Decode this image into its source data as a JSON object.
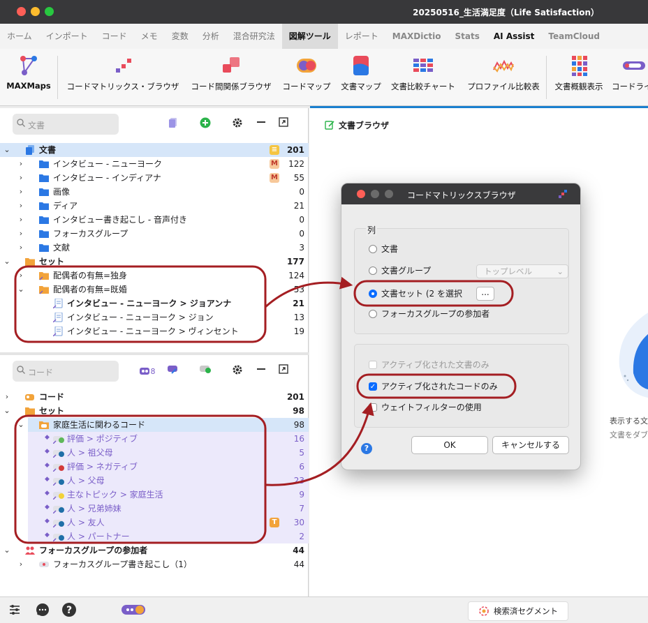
{
  "window": {
    "title": "20250516_生活満足度（Life Satisfaction）"
  },
  "ribbon_tabs": [
    {
      "label": "ホーム"
    },
    {
      "label": "インポート"
    },
    {
      "label": "コード"
    },
    {
      "label": "メモ"
    },
    {
      "label": "変数"
    },
    {
      "label": "分析"
    },
    {
      "label": "混合研究法"
    },
    {
      "label": "図解ツール"
    },
    {
      "label": "レポート"
    },
    {
      "label": "MAXDictio"
    },
    {
      "label": "Stats"
    },
    {
      "label": "AI Assist"
    },
    {
      "label": "TeamCloud"
    }
  ],
  "toolbar": [
    {
      "label": "MAXMaps",
      "icon": "maxmaps-icon"
    },
    {
      "label": "コードマトリックス・ブラウザ",
      "icon": "code-matrix-icon"
    },
    {
      "label": "コード間関係ブラウザ",
      "icon": "code-relations-icon"
    },
    {
      "label": "コードマップ",
      "icon": "code-map-icon"
    },
    {
      "label": "文書マップ",
      "icon": "document-map-icon"
    },
    {
      "label": "文書比較チャート",
      "icon": "document-comparison-icon"
    },
    {
      "label": "プロファイル比較表",
      "icon": "profile-comparison-icon"
    },
    {
      "label": "文書概観表示",
      "icon": "document-portrait-icon"
    },
    {
      "label": "コードライ",
      "icon": "codeline-icon"
    }
  ],
  "documents_panel": {
    "search_placeholder": "文書",
    "rows": [
      {
        "label": "文書",
        "count": "201"
      },
      {
        "label": "インタビュー - ニューヨーク",
        "count": "122"
      },
      {
        "label": "インタビュー - インディアナ",
        "count": "55"
      },
      {
        "label": "画像",
        "count": "0"
      },
      {
        "label": "ディア",
        "count": "21"
      },
      {
        "label": "インタビュー書き起こし - 音声付き",
        "count": "0"
      },
      {
        "label": "フォーカスグループ",
        "count": "0"
      },
      {
        "label": "文献",
        "count": "3"
      },
      {
        "label": "セット",
        "count": "177"
      },
      {
        "label": "配偶者の有無=独身",
        "count": "124"
      },
      {
        "label": "配偶者の有無=既婚",
        "count": "53"
      },
      {
        "label": "インタビュー - ニューヨーク > ジョアンナ",
        "count": "21"
      },
      {
        "label": "インタビュー - ニューヨーク > ジョン",
        "count": "13"
      },
      {
        "label": "インタビュー - ニューヨーク > ヴィンセント",
        "count": "19"
      }
    ],
    "badges": {
      "m": "M",
      "equals": "="
    }
  },
  "codes_panel": {
    "search_placeholder": "コード",
    "activated_count": "8",
    "rows": [
      {
        "label": "コード",
        "count": "201"
      },
      {
        "label": "セット",
        "count": "98"
      },
      {
        "label": "家庭生活に関わるコード",
        "count": "98"
      },
      {
        "label": "評価 > ポジティブ",
        "count": "16"
      },
      {
        "label": "人 > 祖父母",
        "count": "5"
      },
      {
        "label": "評価 > ネガティブ",
        "count": "6"
      },
      {
        "label": "人 > 父母",
        "count": "23"
      },
      {
        "label": "主なトピック > 家庭生活",
        "count": "9"
      },
      {
        "label": "人 > 兄弟姉妹",
        "count": "7"
      },
      {
        "label": "人 > 友人",
        "count": "30"
      },
      {
        "label": "人 > パートナー",
        "count": "2"
      },
      {
        "label": "フォーカスグループの参加者",
        "count": "44"
      },
      {
        "label": "フォーカスグループ書き起こし（1）",
        "count": "44"
      }
    ],
    "badge_t": "T"
  },
  "right_pane": {
    "title": "文書ブラウザ",
    "hint1": "表示する文",
    "hint2": "文書をダブ"
  },
  "dialog": {
    "title": "コードマトリックスブラウザ",
    "group_label": "列",
    "options": {
      "documents": "文書",
      "document_groups": "文書グループ",
      "document_sets": "文書セット (2 を選択",
      "focus_participants": "フォーカスグループの参加者"
    },
    "select_value": "トップレベル",
    "dots_label": "...",
    "checkboxes": {
      "activated_docs": "アクティブ化された文書のみ",
      "activated_codes": "アクティブ化されたコードのみ",
      "weight_filter": "ウェイトフィルターの使用"
    },
    "ok_label": "OK",
    "cancel_label": "キャンセルする",
    "help_label": "?"
  },
  "bottom_bar": {
    "retrieved_segments": "検索済セグメント"
  },
  "colors": {
    "accent": "#1a7fcf",
    "annotation": "#a41e22",
    "selection": "#d6e6f9",
    "highlight": "#ece9fb"
  }
}
